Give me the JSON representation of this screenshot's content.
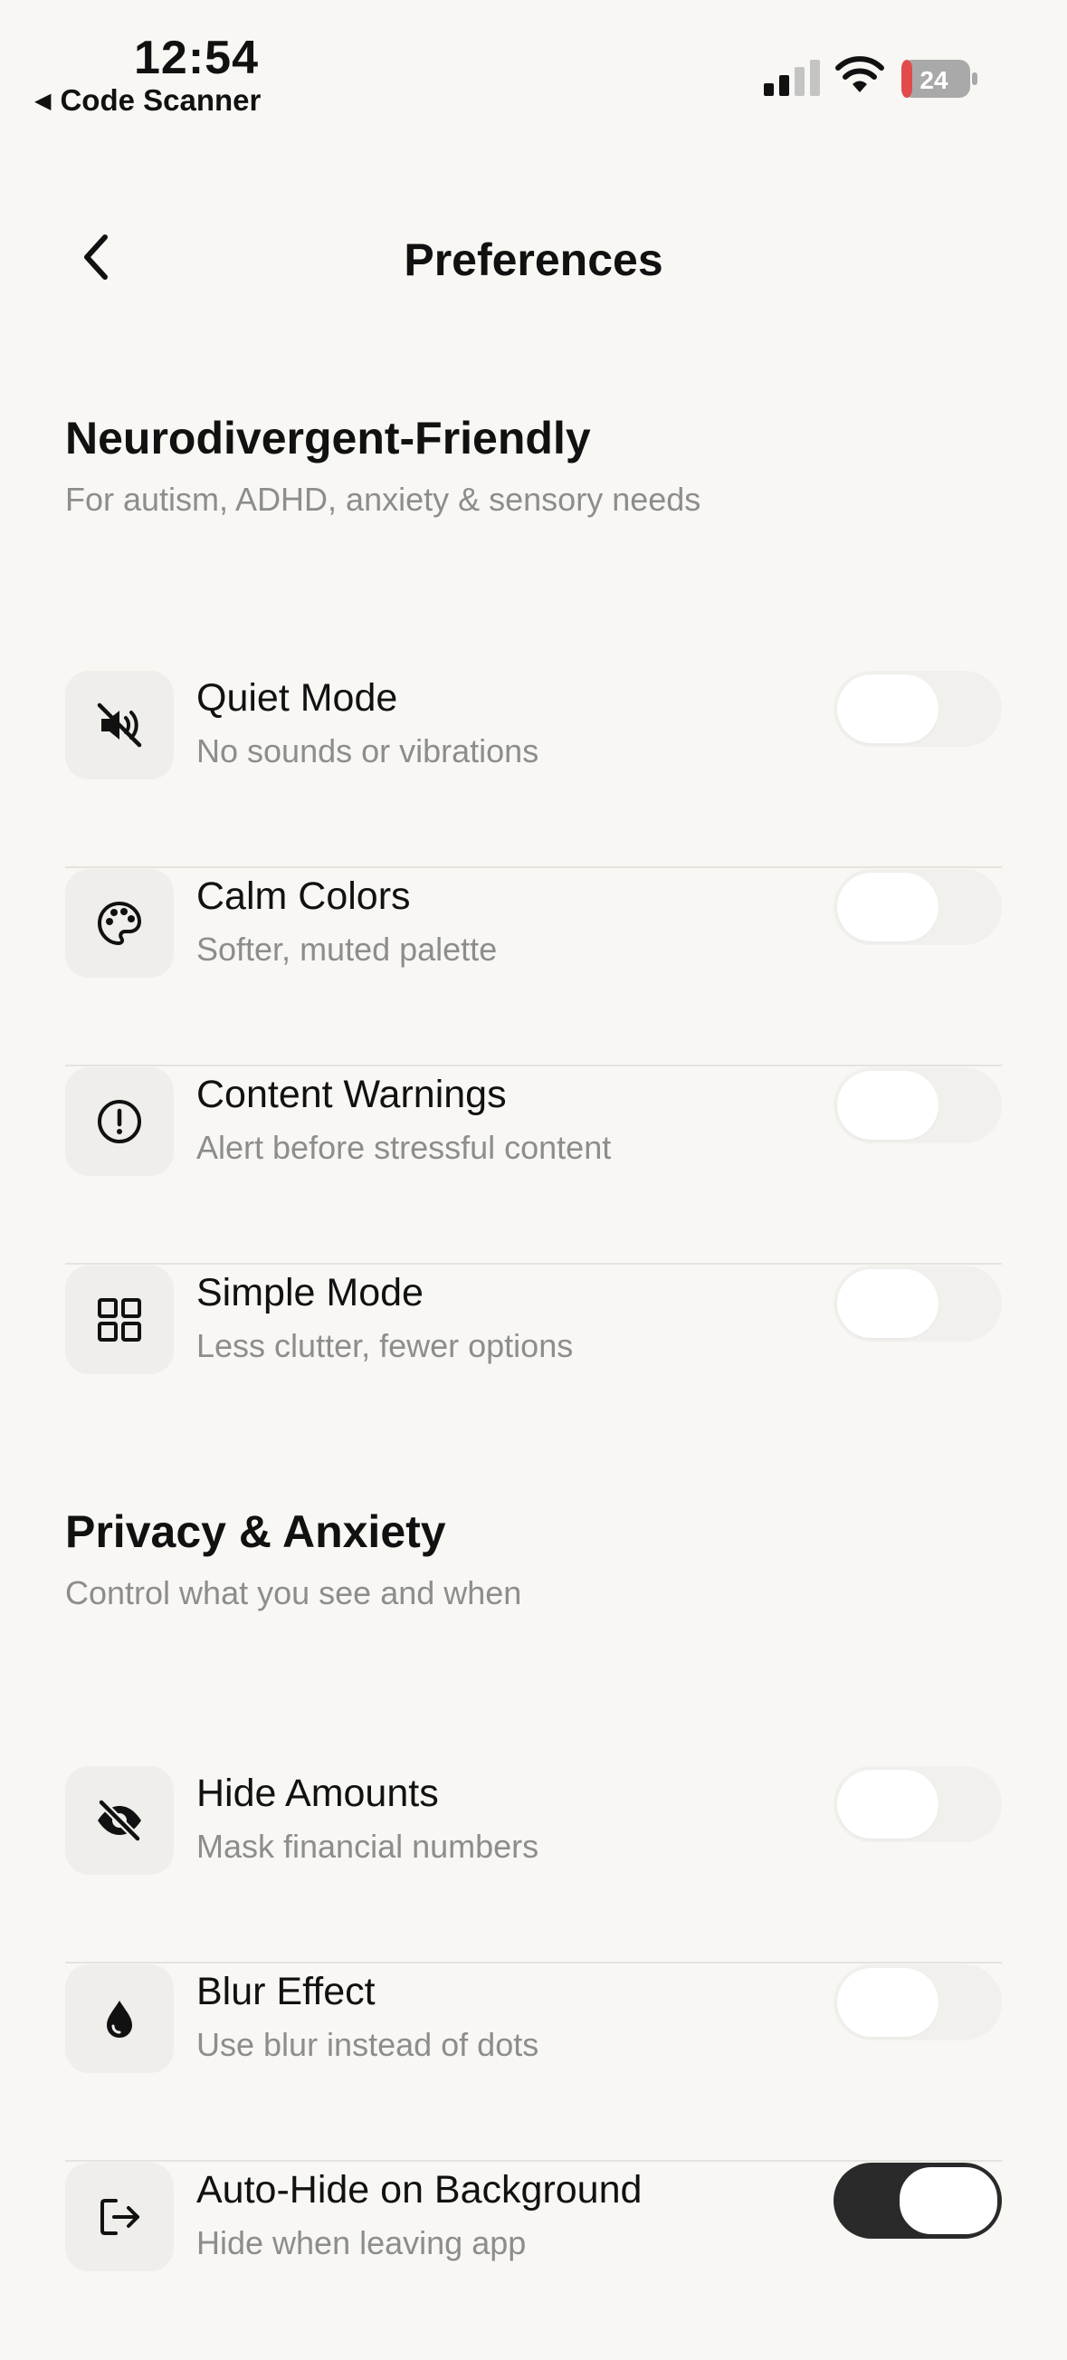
{
  "status_bar": {
    "time": "12:54",
    "back_app": "Code Scanner",
    "battery": "24"
  },
  "nav": {
    "title": "Preferences"
  },
  "sections": [
    {
      "title": "Neurodivergent-Friendly",
      "subtitle": "For autism, ADHD, anxiety & sensory needs",
      "items": [
        {
          "label": "Quiet Mode",
          "description": "No sounds or vibrations",
          "icon": "speaker-muted-icon",
          "enabled": false
        },
        {
          "label": "Calm Colors",
          "description": "Softer, muted palette",
          "icon": "palette-icon",
          "enabled": false
        },
        {
          "label": "Content Warnings",
          "description": "Alert before stressful content",
          "icon": "alert-circle-icon",
          "enabled": false
        },
        {
          "label": "Simple Mode",
          "description": "Less clutter, fewer options",
          "icon": "grid-icon",
          "enabled": false
        }
      ]
    },
    {
      "title": "Privacy & Anxiety",
      "subtitle": "Control what you see and when",
      "items": [
        {
          "label": "Hide Amounts",
          "description": "Mask financial numbers",
          "icon": "eye-off-icon",
          "enabled": false
        },
        {
          "label": "Blur Effect",
          "description": "Use blur instead of dots",
          "icon": "droplet-icon",
          "enabled": false
        },
        {
          "label": "Auto-Hide on Background",
          "description": "Hide when leaving app",
          "icon": "exit-icon",
          "enabled": true
        }
      ]
    }
  ],
  "colors": {
    "background": "#f8f7f4",
    "icon_box": "#efeeea",
    "toggle_off": "#f1f0ed",
    "toggle_on": "#2a2a2a",
    "secondary_text": "#8d8d8d"
  }
}
